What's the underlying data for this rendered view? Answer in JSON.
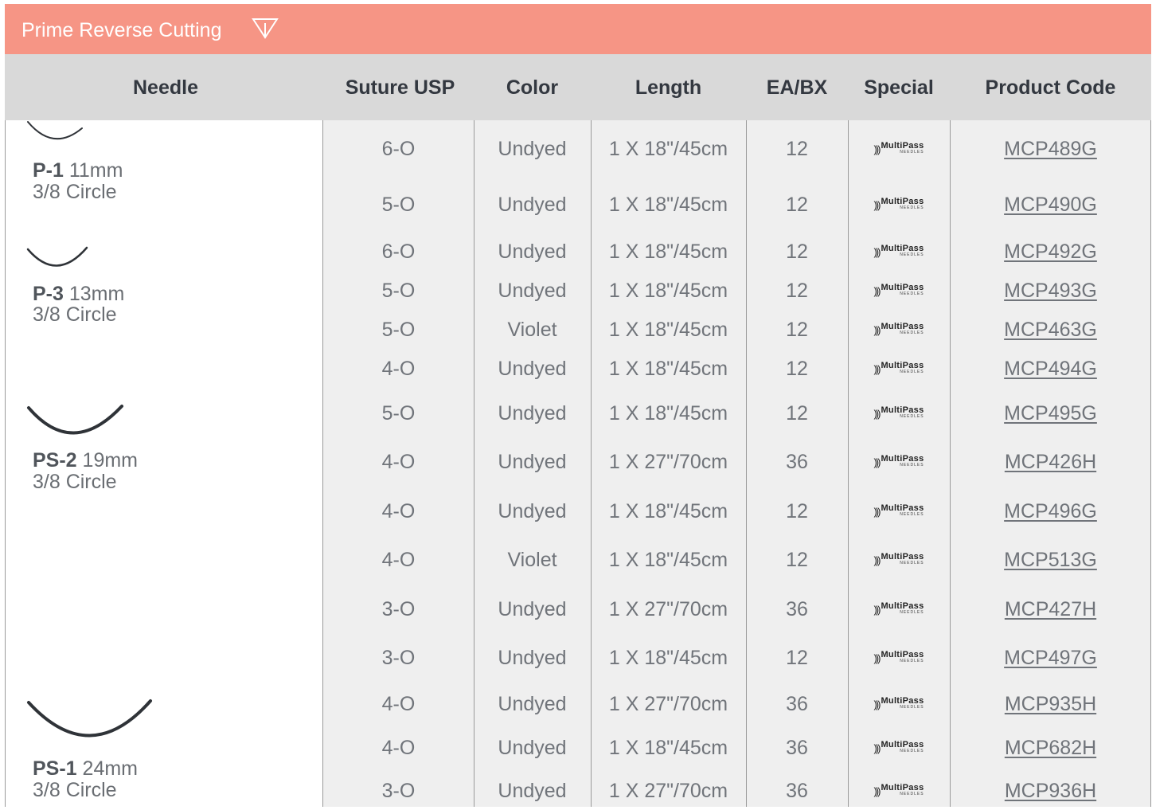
{
  "banner": {
    "title": "Prime Reverse Cutting",
    "icon": "funnel-icon",
    "color": "#f69585"
  },
  "columns": [
    "Needle",
    "Suture USP",
    "Color",
    "Length",
    "EA/BX",
    "Special",
    "Product Code"
  ],
  "special_logo": {
    "main": "MultiPass",
    "sub": "NEEDLES",
    "icon": "multipass-logo-icon"
  },
  "groups": [
    {
      "needle": {
        "code": "P-1",
        "size": "11mm",
        "shape": "3/8 Circle"
      },
      "rows": [
        {
          "usp": "6-O",
          "color": "Undyed",
          "length": "1 X 18\"/45cm",
          "ea": "12",
          "code": "MCP489G"
        },
        {
          "usp": "5-O",
          "color": "Undyed",
          "length": "1 X 18\"/45cm",
          "ea": "12",
          "code": "MCP490G"
        }
      ]
    },
    {
      "needle": {
        "code": "P-3",
        "size": "13mm",
        "shape": "3/8 Circle"
      },
      "rows": [
        {
          "usp": "6-O",
          "color": "Undyed",
          "length": "1 X 18\"/45cm",
          "ea": "12",
          "code": "MCP492G"
        },
        {
          "usp": "5-O",
          "color": "Undyed",
          "length": "1 X 18\"/45cm",
          "ea": "12",
          "code": "MCP493G"
        },
        {
          "usp": "5-O",
          "color": "Violet",
          "length": "1 X 18\"/45cm",
          "ea": "12",
          "code": "MCP463G"
        },
        {
          "usp": "4-O",
          "color": "Undyed",
          "length": "1 X 18\"/45cm",
          "ea": "12",
          "code": "MCP494G"
        }
      ]
    },
    {
      "needle": {
        "code": "PS-2",
        "size": "19mm",
        "shape": "3/8 Circle"
      },
      "rows": [
        {
          "usp": "5-O",
          "color": "Undyed",
          "length": "1 X 18\"/45cm",
          "ea": "12",
          "code": "MCP495G"
        },
        {
          "usp": "4-O",
          "color": "Undyed",
          "length": "1 X 27\"/70cm",
          "ea": "36",
          "code": "MCP426H"
        },
        {
          "usp": "4-O",
          "color": "Undyed",
          "length": "1 X 18\"/45cm",
          "ea": "12",
          "code": "MCP496G"
        },
        {
          "usp": "4-O",
          "color": "Violet",
          "length": "1 X 18\"/45cm",
          "ea": "12",
          "code": "MCP513G"
        },
        {
          "usp": "3-O",
          "color": "Undyed",
          "length": "1 X 27\"/70cm",
          "ea": "36",
          "code": "MCP427H"
        },
        {
          "usp": "3-O",
          "color": "Undyed",
          "length": "1 X 18\"/45cm",
          "ea": "12",
          "code": "MCP497G"
        }
      ]
    },
    {
      "needle": {
        "code": "PS-1",
        "size": "24mm",
        "shape": "3/8 Circle"
      },
      "rows": [
        {
          "usp": "4-O",
          "color": "Undyed",
          "length": "1 X 27\"/70cm",
          "ea": "36",
          "code": "MCP935H"
        },
        {
          "usp": "4-O",
          "color": "Undyed",
          "length": "1 X 18\"/45cm",
          "ea": "36",
          "code": "MCP682H"
        },
        {
          "usp": "3-O",
          "color": "Undyed",
          "length": "1 X 27\"/70cm",
          "ea": "36",
          "code": "MCP936H"
        }
      ]
    }
  ]
}
